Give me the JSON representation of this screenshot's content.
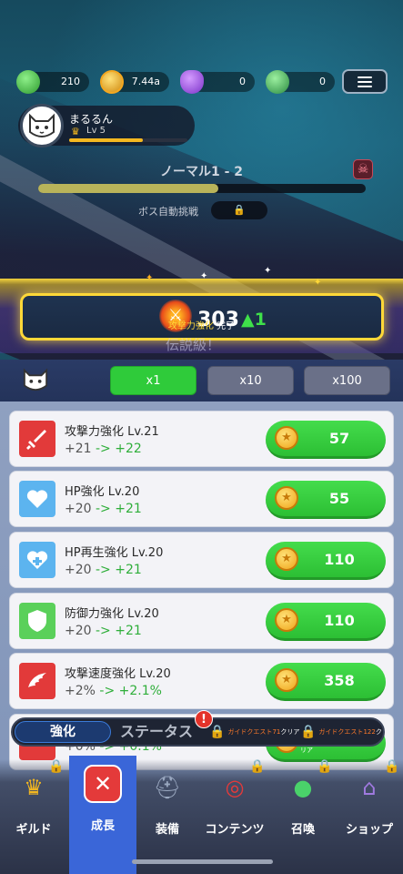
{
  "resources": {
    "gems": "210",
    "gold": "7.44a",
    "purple": "0",
    "green": "0"
  },
  "player": {
    "name": "まるるん",
    "level": "Lv 5"
  },
  "stage": {
    "title": "ノーマル1 - 2",
    "auto_boss_label": "ボス自動挑戦"
  },
  "banner": {
    "power": "303",
    "delta": "▲1",
    "stat_name": "攻撃力強化",
    "status": "完了",
    "background_text": "伝説級！"
  },
  "multipliers": [
    "x1",
    "x10",
    "x100"
  ],
  "upgrades": [
    {
      "title": "攻撃力強化 Lv.21",
      "old": "+21",
      "arrow": "->",
      "new": "+22",
      "cost": "57",
      "icon": "sword-icon"
    },
    {
      "title": "HP強化 Lv.20",
      "old": "+20",
      "arrow": "->",
      "new": "+21",
      "cost": "55",
      "icon": "heart-icon"
    },
    {
      "title": "HP再生強化 Lv.20",
      "old": "+20",
      "arrow": "->",
      "new": "+21",
      "cost": "110",
      "icon": "heart-plus-icon"
    },
    {
      "title": "防御力強化 Lv.20",
      "old": "+20",
      "arrow": "->",
      "new": "+21",
      "cost": "110",
      "icon": "shield-icon"
    },
    {
      "title": "攻撃速度強化 Lv.20",
      "old": "+2%",
      "arrow": "->",
      "new": "+2.1%",
      "cost": "358",
      "icon": "wing-icon"
    },
    {
      "title": "",
      "old": "+0%",
      "arrow": "->",
      "new": "+0.1%",
      "cost": "1",
      "icon": "sword-icon"
    }
  ],
  "subtabs": {
    "active": "強化",
    "status": "ステータス",
    "alert": "!",
    "quest1_prefix": "ガイドクエスト",
    "quest1_num": "71",
    "quest1_suffix": "クリア",
    "quest2_prefix": "ガイドクエスト",
    "quest2_num": "122",
    "quest2_suffix": "クリア"
  },
  "nav": [
    {
      "label": "ギルド",
      "icon": "guild-crown-icon"
    },
    {
      "label": "成長",
      "icon": "growth-close-icon"
    },
    {
      "label": "装備",
      "icon": "helmet-icon"
    },
    {
      "label": "コンテンツ",
      "icon": "target-icon"
    },
    {
      "label": "召喚",
      "icon": "summon-slime-icon"
    },
    {
      "label": "ショップ",
      "icon": "shop-icon"
    }
  ],
  "colors": {
    "active_green": "#2fcb3a",
    "nav_active": "#3a66d8",
    "icon_red": "#e23a3a",
    "icon_blue": "#5cb4ef",
    "icon_green": "#5ad05a",
    "banner_gold": "#ffd838"
  }
}
